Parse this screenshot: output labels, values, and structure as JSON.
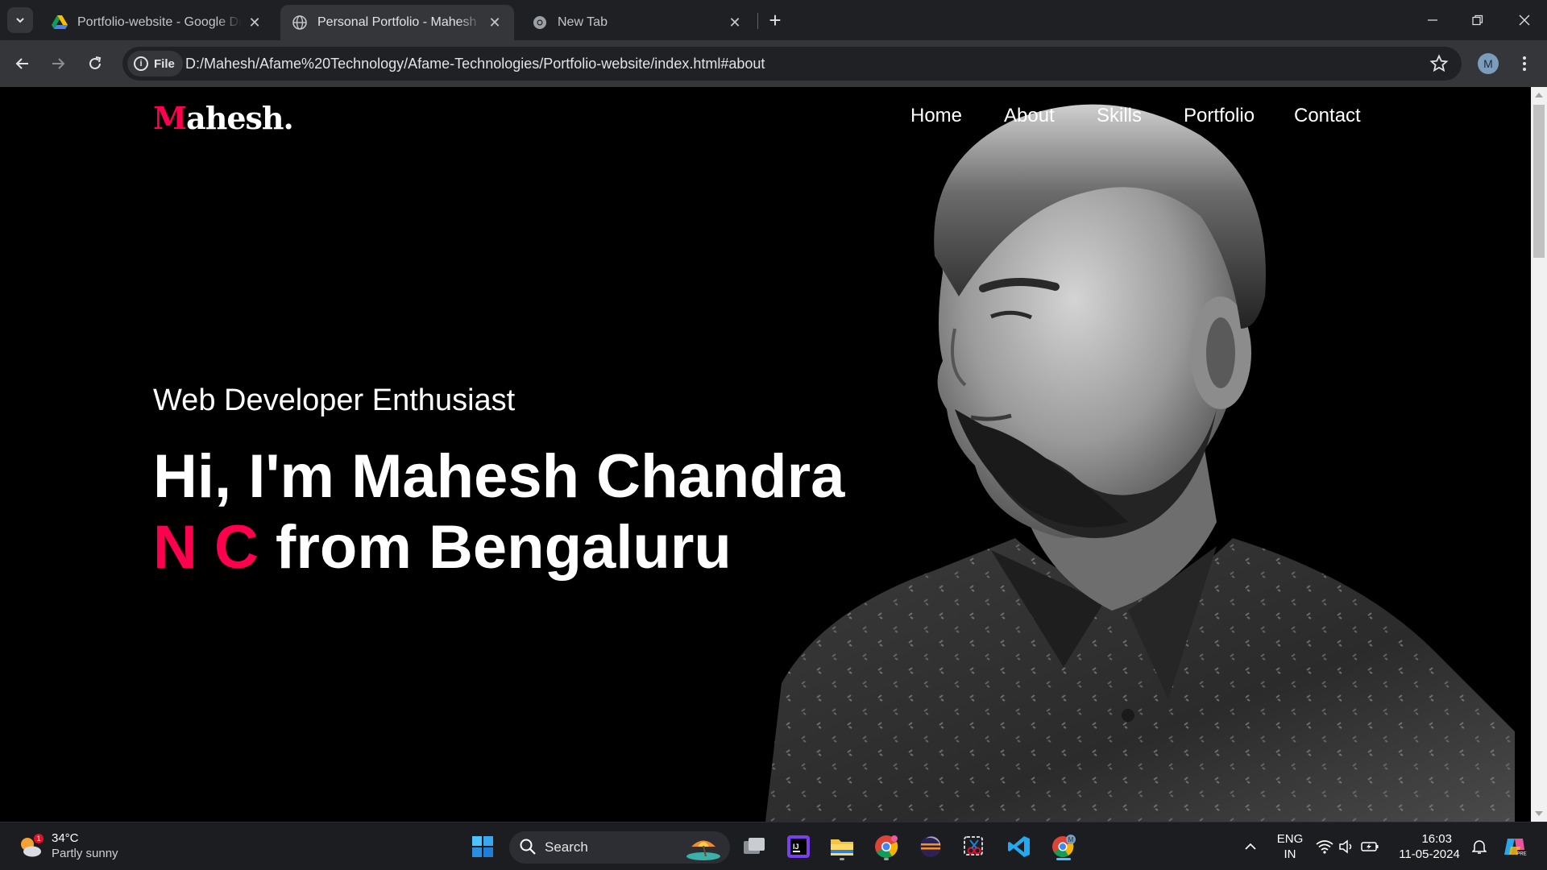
{
  "browser": {
    "tabs": [
      {
        "title": "Portfolio-website - Google Drive",
        "favicon": "google-drive-icon",
        "active": false
      },
      {
        "title": "Personal Portfolio - Mahesh Chandra",
        "favicon": "globe-icon",
        "active": true
      },
      {
        "title": "New Tab",
        "favicon": "chrome-icon",
        "active": false
      }
    ],
    "address": {
      "scheme_chip": "File",
      "url": "D:/Mahesh/Afame%20Technology/Afame-Technologies/Portfolio-website/index.html#about"
    },
    "profile_initial": "M"
  },
  "site": {
    "logo": {
      "first_letter": "M",
      "rest": "ahesh."
    },
    "nav": [
      "Home",
      "About",
      "Skills",
      "Portfolio",
      "Contact"
    ],
    "hero": {
      "tagline": "Web Developer Enthusiast",
      "headline_part1": "Hi, I'm Mahesh Chandra",
      "headline_accent": "N C",
      "headline_part2": "from Bengaluru"
    },
    "accent_color": "#ff004f",
    "background_color": "#000000"
  },
  "taskbar": {
    "weather": {
      "temperature": "34°C",
      "condition": "Partly sunny",
      "badge": "1"
    },
    "search_placeholder": "Search",
    "tray": {
      "language_line1": "ENG",
      "language_line2": "IN",
      "time": "16:03",
      "date": "11-05-2024"
    }
  }
}
